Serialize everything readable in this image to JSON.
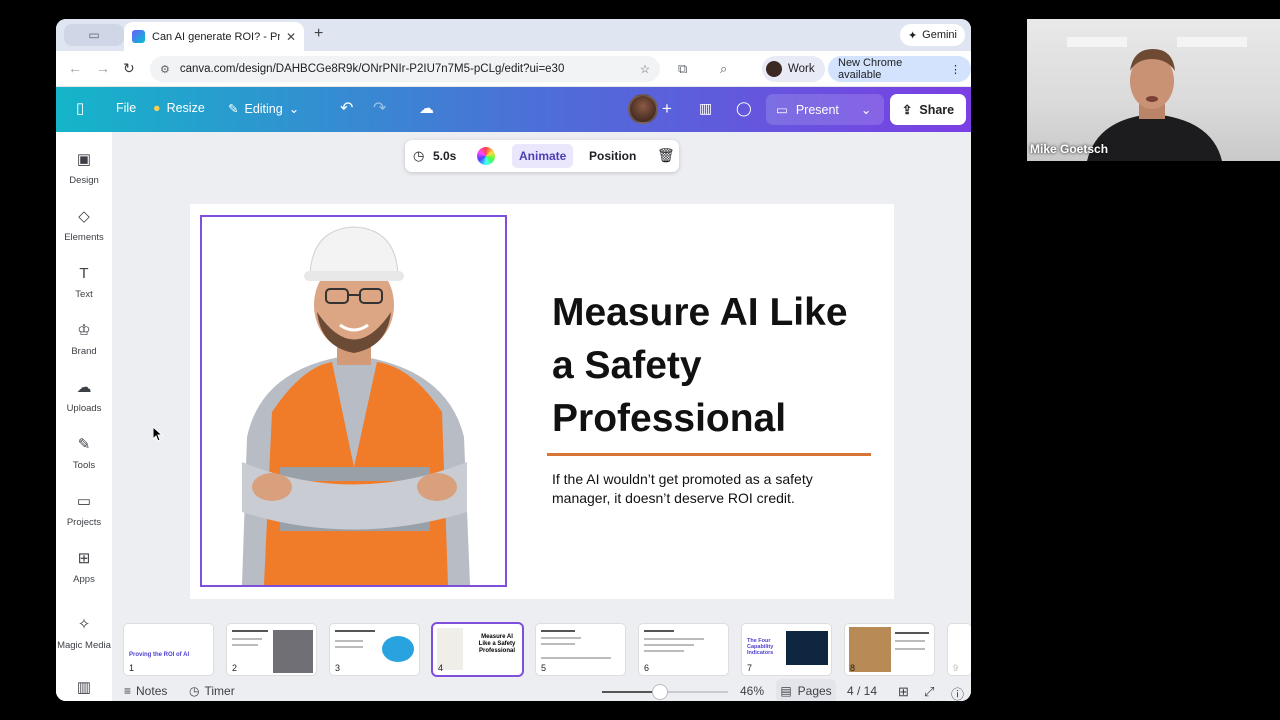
{
  "browser": {
    "tab_title": "Can AI generate ROI? - Prese",
    "new_tab": "+",
    "gemini_label": "Gemini",
    "url": "canva.com/design/DAHBCGe8R9k/ONrPNIr-P2IU7n7M5-pCLg/edit?ui=e30",
    "profile_label": "Work",
    "update_label": "New Chrome available"
  },
  "canva_header": {
    "file": "File",
    "resize": "Resize",
    "editing": "Editing",
    "present": "Present",
    "share": "Share"
  },
  "sidebar": {
    "items": [
      {
        "label": "Design",
        "icon": "design-icon"
      },
      {
        "label": "Elements",
        "icon": "elements-icon"
      },
      {
        "label": "Text",
        "icon": "text-icon"
      },
      {
        "label": "Brand",
        "icon": "brand-icon"
      },
      {
        "label": "Uploads",
        "icon": "uploads-icon"
      },
      {
        "label": "Tools",
        "icon": "tools-icon"
      },
      {
        "label": "Projects",
        "icon": "projects-icon"
      },
      {
        "label": "Apps",
        "icon": "apps-icon"
      },
      {
        "label": "Magic Media",
        "icon": "magic-media-icon"
      }
    ]
  },
  "floating_toolbar": {
    "duration": "5.0s",
    "animate": "Animate",
    "position": "Position"
  },
  "slide": {
    "title": "Measure AI Like a Safety Professional",
    "subtitle": "If the AI wouldn’t get promoted as a safety manager, it doesn’t deserve ROI credit."
  },
  "thumbnails": [
    {
      "num": "1",
      "caption": "Proving the ROI of AI"
    },
    {
      "num": "2",
      "caption": ""
    },
    {
      "num": "3",
      "caption": ""
    },
    {
      "num": "4",
      "caption": "Measure AI Like a Safety Professional"
    },
    {
      "num": "5",
      "caption": ""
    },
    {
      "num": "6",
      "caption": ""
    },
    {
      "num": "7",
      "caption": "The Four Capability Indicators"
    },
    {
      "num": "8",
      "caption": ""
    },
    {
      "num": "9",
      "caption": ""
    }
  ],
  "bottom_bar": {
    "notes": "Notes",
    "timer": "Timer",
    "zoom": "46%",
    "zoom_value": 0.46,
    "pages": "Pages",
    "page_count": "4 / 14"
  },
  "webcam": {
    "name": "Mike Goetsch"
  },
  "colors": {
    "accent_purple": "#7d4fdb",
    "rule_orange": "#d87436",
    "header_gradient_start": "#14b5c9",
    "header_gradient_end": "#7b3fe4"
  }
}
